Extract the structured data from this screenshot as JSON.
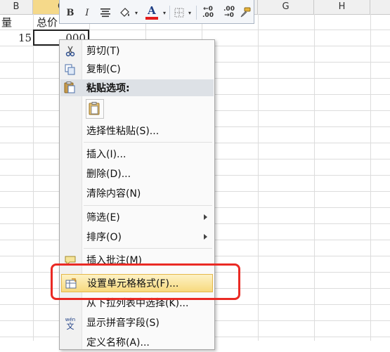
{
  "columns": {
    "b": "B",
    "c": "C",
    "g": "G",
    "h": "H"
  },
  "cells": {
    "a1_partial": "量",
    "b1": "总价",
    "a2": "15",
    "b2_partial": "000"
  },
  "mini_toolbar": {
    "bold": "B",
    "italic": "I",
    "align_icon": "align-center-icon",
    "fill_icon": "fill-color-icon",
    "font_color": "A",
    "font_color_bar": "#e41b1b",
    "border_icon": "borders-icon",
    "increase_decimal": ".00",
    "decrease_decimal": ".00",
    "format_painter_icon": "format-painter-icon"
  },
  "context_menu": {
    "cut": "剪切(T)",
    "copy": "复制(C)",
    "paste_options": "粘贴选项:",
    "paste_special": "选择性粘贴(S)...",
    "insert": "插入(I)...",
    "delete": "删除(D)...",
    "clear_contents": "清除内容(N)",
    "filter": "筛选(E)",
    "sort": "排序(O)",
    "insert_comment": "插入批注(M)",
    "format_cells": "设置单元格格式(F)...",
    "pick_from_list": "从下拉列表中选择(K)...",
    "show_phonetic": "显示拼音字段(S)",
    "define_name": "定义名称(A)..."
  },
  "colors": {
    "highlight": "#f7d97d",
    "annotation": "#ea2a24",
    "selected_column": "#f5d98a"
  }
}
